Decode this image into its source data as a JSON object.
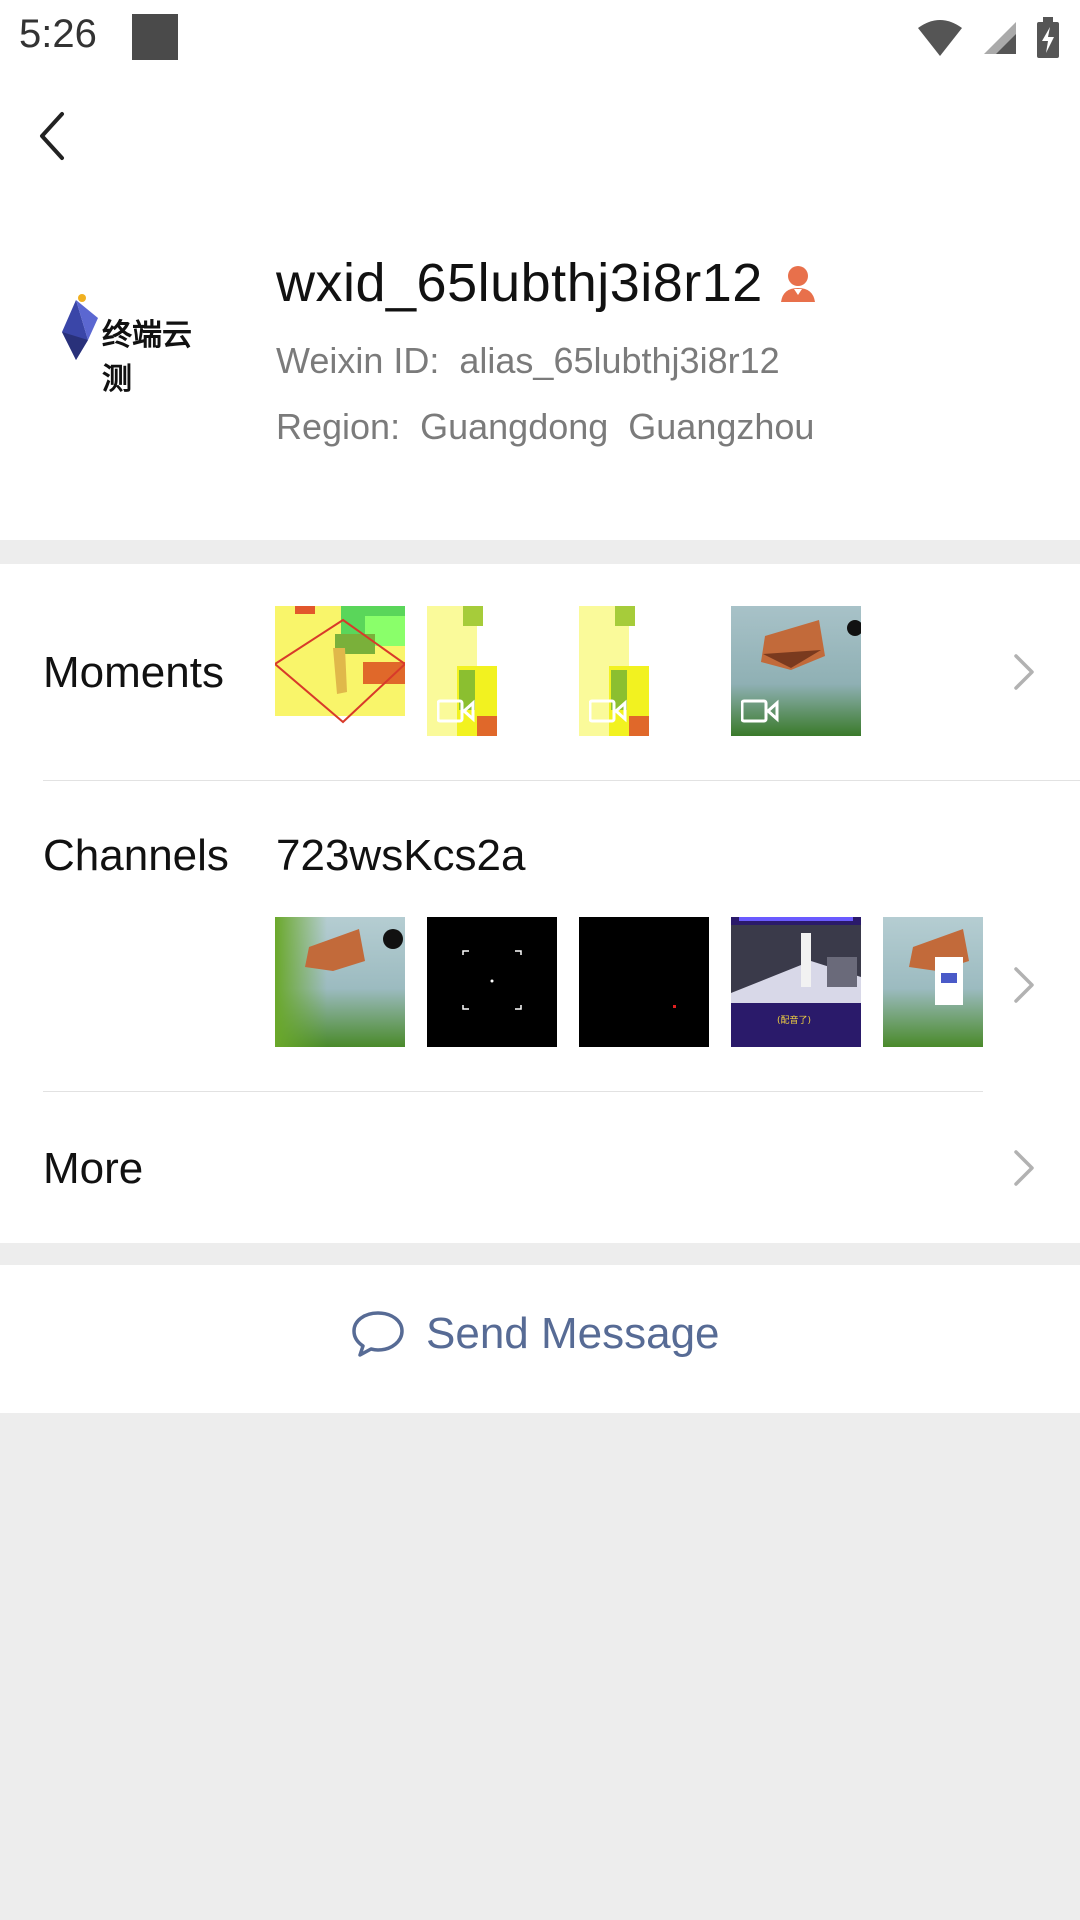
{
  "status_bar": {
    "time": "5:26"
  },
  "profile": {
    "display_name": "wxid_65lubthj3i8r12",
    "weixin_id_label": "Weixin ID:",
    "weixin_id": "alias_65lubthj3i8r12",
    "region_label": "Region:",
    "region_value": "Guangdong  Guangzhou",
    "avatar_text": "终端云测"
  },
  "moments": {
    "label": "Moments"
  },
  "channels": {
    "label": "Channels",
    "channel_name": "723wsKcs2a",
    "thumb_caption": "(配音了)"
  },
  "more": {
    "label": "More"
  },
  "actions": {
    "send_message": "Send Message"
  },
  "colors": {
    "accent": "#576b95",
    "gender_icon": "#e8704b"
  }
}
